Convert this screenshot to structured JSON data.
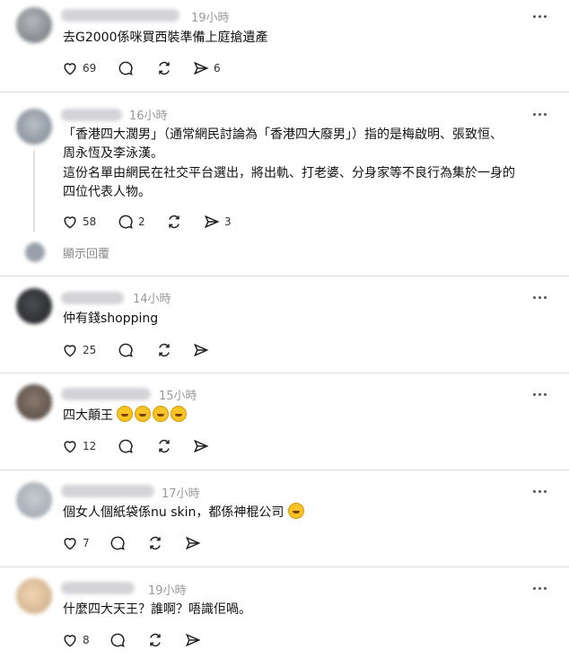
{
  "posts": [
    {
      "time": "19小時",
      "lines": [
        "去G2000係咪買西裝準備上庭搶遺產"
      ],
      "likes": "69",
      "replies": "",
      "shares": "6"
    },
    {
      "time": "16小時",
      "lines": [
        "「香港四大濶男」（通常網民討論為「香港四大廢男」）指的是梅啟明、張致恒、",
        "周永恆及李泳漢。",
        "這份名單由網民在社交平台選出，將出軌、打老婆、分身家等不良行為集於一身的",
        "四位代表人物。"
      ],
      "likes": "58",
      "replies": "2",
      "shares": "3",
      "hidden_reply": "顯示回覆"
    },
    {
      "time": "14小時",
      "lines": [
        "仲有錢shopping"
      ],
      "likes": "25",
      "replies": "",
      "shares": ""
    },
    {
      "time": "15小時",
      "lines": [
        "四大顛王"
      ],
      "likes": "12",
      "replies": "",
      "shares": ""
    },
    {
      "time": "17小時",
      "lines": [
        "個女人個紙袋係nu skin，都係神棍公司"
      ],
      "likes": "7",
      "replies": "",
      "shares": ""
    },
    {
      "time": "19小時",
      "lines": [
        "什麼四大天王？誰啊？唔識佢喎。"
      ],
      "likes": "8",
      "replies": "",
      "shares": ""
    }
  ]
}
